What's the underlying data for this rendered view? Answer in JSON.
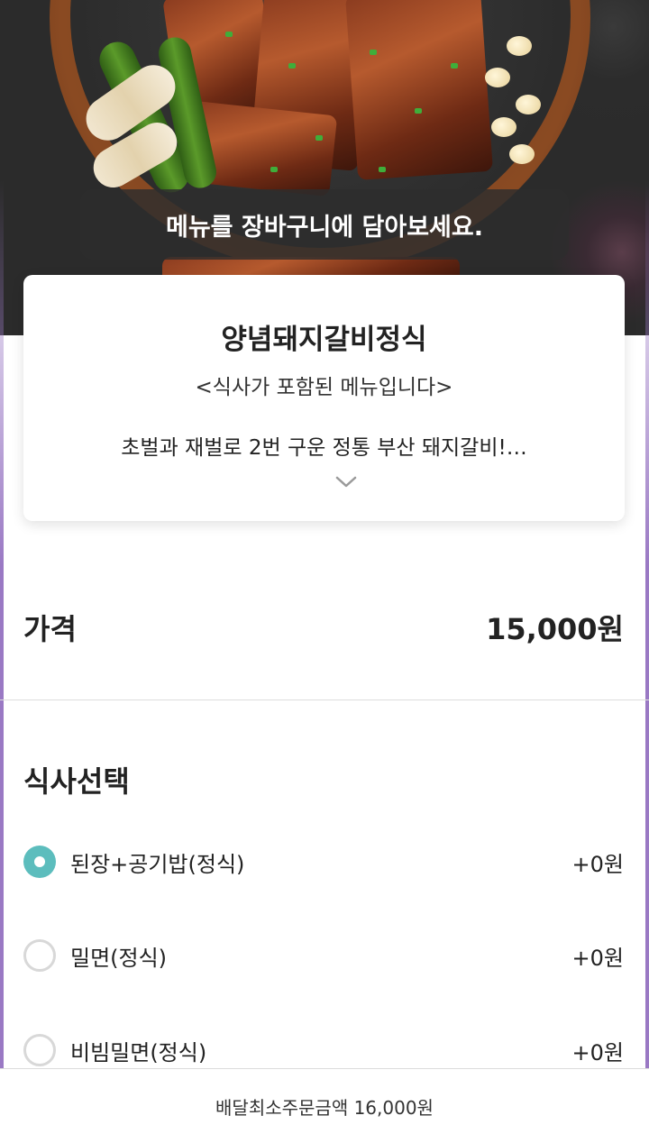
{
  "toast": {
    "text": "메뉴를 장바구니에 담아보세요."
  },
  "menu": {
    "title": "양념돼지갈비정식",
    "subtitle": "<식사가 포함된 메뉴입니다>",
    "description": "초벌과 재벌로 2번 구운 정통 부산 돼지갈비!…",
    "expand_icon": "chevron-down-icon"
  },
  "price": {
    "label": "가격",
    "value": "15,000원"
  },
  "options": {
    "title": "식사선택",
    "items": [
      {
        "label": "된장+공기밥(정식)",
        "price": "+0원",
        "selected": true
      },
      {
        "label": "밀면(정식)",
        "price": "+0원",
        "selected": false
      },
      {
        "label": "비빔밀면(정식)",
        "price": "+0원",
        "selected": false
      }
    ]
  },
  "footer": {
    "text": "배달최소주문금액 16,000원"
  },
  "colors": {
    "accent": "#5cbdbd",
    "toast_bg": "#2d2d2d"
  }
}
